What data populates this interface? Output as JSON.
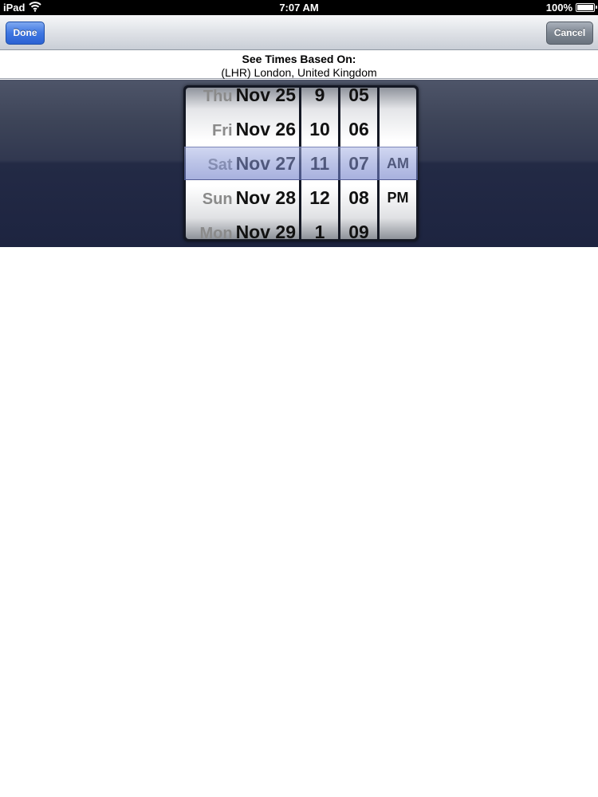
{
  "status_bar": {
    "device": "iPad",
    "time": "7:07 AM",
    "battery": "100%"
  },
  "toolbar": {
    "done_label": "Done",
    "cancel_label": "Cancel"
  },
  "header": {
    "title": "See Times Based On:",
    "subtitle": "(LHR) London, United Kingdom"
  },
  "picker": {
    "date_rows": [
      {
        "dow": "Thu",
        "date": "Nov 25"
      },
      {
        "dow": "Fri",
        "date": "Nov 26"
      },
      {
        "dow": "Sat",
        "date": "Nov 27"
      },
      {
        "dow": "Sun",
        "date": "Nov 28"
      },
      {
        "dow": "Mon",
        "date": "Nov 29"
      }
    ],
    "hours": [
      "9",
      "10",
      "11",
      "12",
      "1"
    ],
    "minutes": [
      "05",
      "06",
      "07",
      "08",
      "09"
    ],
    "ampm": [
      "AM",
      "PM"
    ],
    "selected": {
      "date": "Sat Nov 27",
      "hour": "11",
      "minute": "07",
      "ampm": "AM"
    }
  },
  "colors": {
    "done_button": "#3f77e2",
    "cancel_button": "#7e8792",
    "selection_highlight": "#8291d2"
  },
  "icons": [
    "wifi-icon",
    "battery-icon"
  ]
}
